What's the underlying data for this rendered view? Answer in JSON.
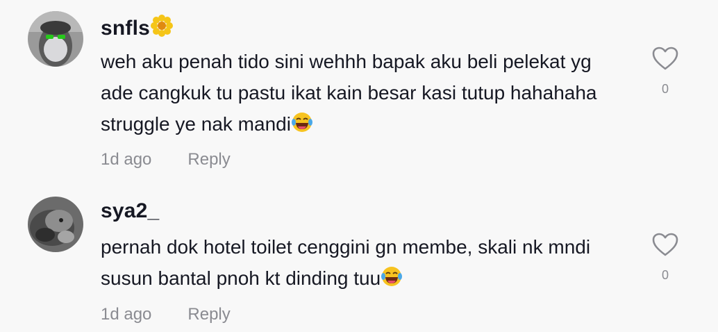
{
  "comments": [
    {
      "username": "snfls",
      "username_emoji": "flower-icon",
      "text": "weh aku penah tido sini wehhh bapak aku beli pelekat yg ade cangkuk tu pastu ikat kain besar kasi tutup hahahaha struggle ye nak mandi",
      "text_emoji": "laughing-tears-icon",
      "time": "1d ago",
      "reply_label": "Reply",
      "like_count": "0"
    },
    {
      "username": "sya2_",
      "text": "pernah dok hotel toilet cenggini gn membe, skali nk mndi susun bantal pnoh kt dinding tuu",
      "text_emoji": "laughing-tears-icon",
      "time": "1d ago",
      "reply_label": "Reply",
      "like_count": "0"
    }
  ],
  "colors": {
    "background": "#f8f8f8",
    "primary_text": "#161823",
    "secondary_text": "#8a8b91"
  }
}
